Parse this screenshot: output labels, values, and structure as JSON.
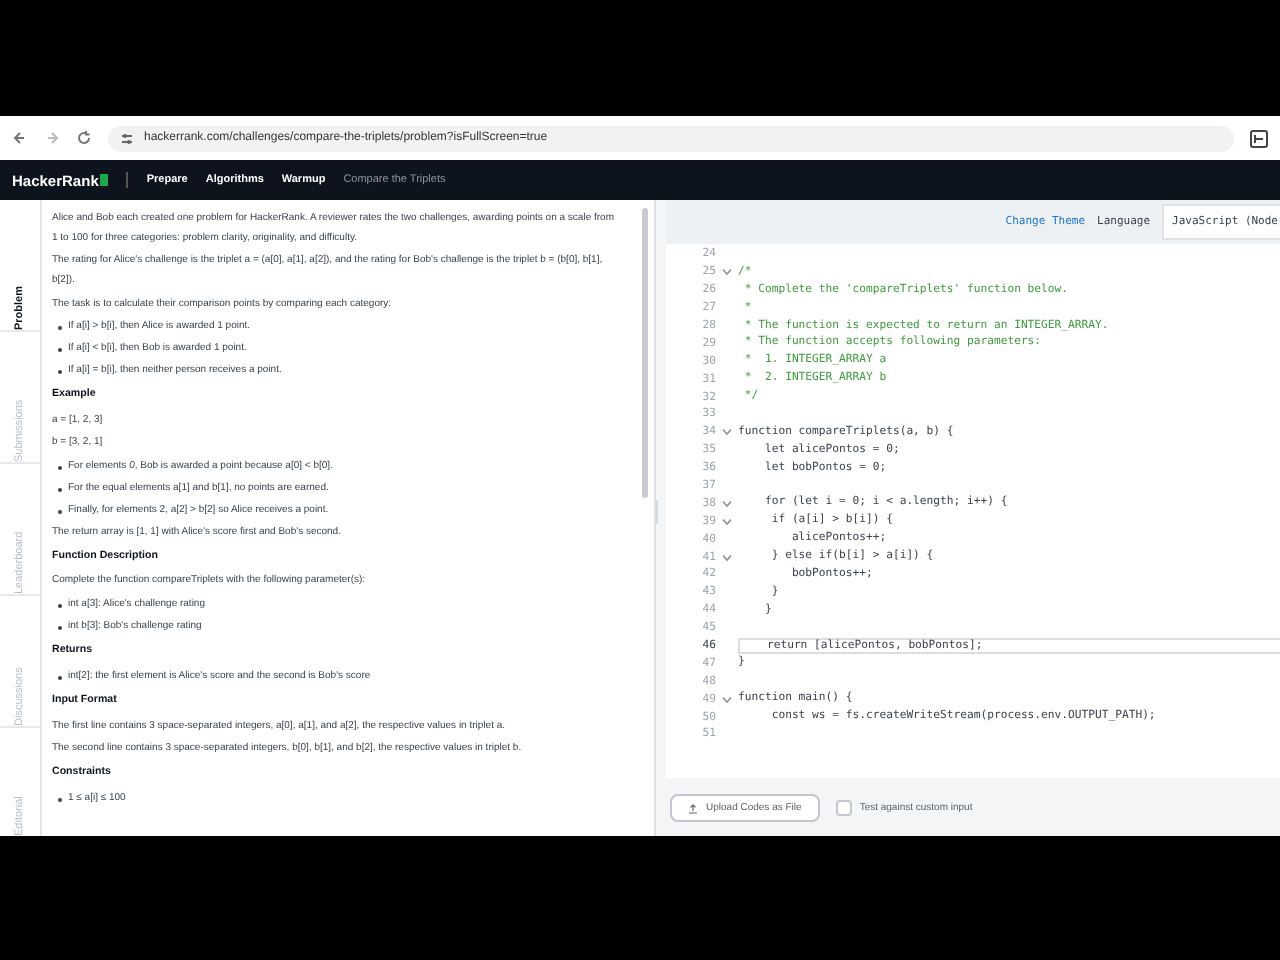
{
  "browser": {
    "url": "hackerrank.com/challenges/compare-the-triplets/problem?isFullScreen=true"
  },
  "header": {
    "logo": "HackerRank",
    "nav": [
      {
        "label": "Prepare",
        "kind": "link"
      },
      {
        "label": "Algorithms",
        "kind": "link"
      },
      {
        "label": "Warmup",
        "kind": "link"
      },
      {
        "label": "Compare the Triplets",
        "kind": "current"
      }
    ]
  },
  "side_tabs": [
    {
      "label": "Problem",
      "selected": true
    },
    {
      "label": "Submissions",
      "selected": false
    },
    {
      "label": "Leaderboard",
      "selected": false
    },
    {
      "label": "Discussions",
      "selected": false
    },
    {
      "label": "Editorial",
      "selected": false
    }
  ],
  "problem": [
    {
      "kind": "p",
      "text": "Alice and Bob each created one problem for HackerRank. A reviewer rates the two challenges, awarding points on a scale from 1 to 100 for three categories: problem clarity, originality, and difficulty."
    },
    {
      "kind": "p",
      "text": "The rating for Alice's challenge is the triplet a = (a[0], a[1], a[2]), and the rating for Bob's challenge is the triplet b = (b[0], b[1], b[2])."
    },
    {
      "kind": "p",
      "text": "The task is to calculate their comparison points by comparing each category:"
    },
    {
      "kind": "li",
      "text": "If a[i] > b[i], then Alice is awarded 1 point."
    },
    {
      "kind": "li",
      "text": "If a[i] < b[i], then Bob is awarded 1 point."
    },
    {
      "kind": "li",
      "text": "If a[i] = b[i], then neither person receives a point."
    },
    {
      "kind": "h",
      "text": "Example"
    },
    {
      "kind": "p",
      "text": "a = [1, 2, 3]"
    },
    {
      "kind": "p",
      "text": "b = [3, 2, 1]"
    },
    {
      "kind": "li",
      "text": "For elements *0*, Bob is awarded a point because a[0] < b[0]."
    },
    {
      "kind": "li",
      "text": "For the equal elements a[1] and b[1], no points are earned."
    },
    {
      "kind": "li",
      "text": "Finally, for elements 2, a[2] > b[2] so Alice receives a point."
    },
    {
      "kind": "p",
      "text": "The return array is [1, 1] with Alice's score first and Bob's second."
    },
    {
      "kind": "h",
      "text": "Function Description"
    },
    {
      "kind": "p",
      "text": "Complete the function compareTriplets with the following parameter(s):"
    },
    {
      "kind": "li",
      "text": "int a[3]: Alice's challenge rating"
    },
    {
      "kind": "li",
      "text": "int b[3]: Bob's challenge rating"
    },
    {
      "kind": "h",
      "text": "Returns"
    },
    {
      "kind": "li",
      "text": "int[2]: the first element is Alice's score and the second is Bob's score"
    },
    {
      "kind": "h",
      "text": "Input Format"
    },
    {
      "kind": "p",
      "text": "The first line contains 3 space-separated integers, a[0], a[1], and a[2], the respective values in triplet a."
    },
    {
      "kind": "p",
      "text": "The second line contains 3 space-separated integers, b[0], b[1], and b[2], the respective values in triplet b."
    },
    {
      "kind": "h",
      "text": "Constraints"
    },
    {
      "kind": "li",
      "text": "1 ≤ a[i] ≤ 100"
    }
  ],
  "editor": {
    "change_theme": "Change Theme",
    "language_label": "Language",
    "language": "JavaScript (Node",
    "lines": [
      {
        "number": "24",
        "kind": "code",
        "fold": false,
        "current": false
      },
      {
        "number": "25",
        "text": "/*",
        "kind": "comment",
        "fold": true,
        "current": false
      },
      {
        "number": "26",
        "text": " * Complete the 'compareTriplets' function below.",
        "kind": "comment",
        "fold": false,
        "current": false
      },
      {
        "number": "27",
        "text": " *",
        "kind": "comment",
        "fold": false,
        "current": false
      },
      {
        "number": "28",
        "text": " * The function is expected to return an INTEGER_ARRAY.",
        "kind": "comment",
        "fold": false,
        "current": false
      },
      {
        "number": "29",
        "text": " * The function accepts following parameters:",
        "kind": "comment",
        "fold": false,
        "current": false
      },
      {
        "number": "30",
        "text": " *  1. INTEGER_ARRAY a",
        "kind": "comment",
        "fold": false,
        "current": false
      },
      {
        "number": "31",
        "text": " *  2. INTEGER_ARRAY b",
        "kind": "comment",
        "fold": false,
        "current": false
      },
      {
        "number": "32",
        "text": " */",
        "kind": "comment",
        "fold": false,
        "current": false
      },
      {
        "number": "33",
        "kind": "code",
        "fold": false,
        "current": false
      },
      {
        "number": "34",
        "text": "function compareTriplets(a, b) {",
        "kind": "code",
        "fold": true,
        "current": false
      },
      {
        "number": "35",
        "text": "    let alicePontos = 0;",
        "kind": "code",
        "fold": false,
        "current": false
      },
      {
        "number": "36",
        "text": "    let bobPontos = 0;",
        "kind": "code",
        "fold": false,
        "current": false
      },
      {
        "number": "37",
        "kind": "code",
        "fold": false,
        "current": false
      },
      {
        "number": "38",
        "text": "    for (let i = 0; i < a.length; i++) {",
        "kind": "code",
        "fold": true,
        "current": false
      },
      {
        "number": "39",
        "text": "     if (a[i] > b[i]) {",
        "kind": "code",
        "fold": true,
        "current": false
      },
      {
        "number": "40",
        "text": "        alicePontos++;",
        "kind": "code",
        "fold": false,
        "current": false
      },
      {
        "number": "41",
        "text": "     } else if(b[i] > a[i]) {",
        "kind": "code",
        "fold": true,
        "current": false
      },
      {
        "number": "42",
        "text": "        bobPontos++;",
        "kind": "code",
        "fold": false,
        "current": false
      },
      {
        "number": "43",
        "text": "     }",
        "kind": "code",
        "fold": false,
        "current": false
      },
      {
        "number": "44",
        "text": "    }",
        "kind": "code",
        "fold": false,
        "current": false
      },
      {
        "number": "45",
        "kind": "code",
        "fold": false,
        "current": false
      },
      {
        "number": "46",
        "text": "    return [alicePontos, bobPontos];",
        "kind": "code",
        "fold": false,
        "current": true
      },
      {
        "number": "47",
        "text": "}",
        "kind": "code",
        "fold": false,
        "current": false
      },
      {
        "number": "48",
        "kind": "code",
        "fold": false,
        "current": false
      },
      {
        "number": "49",
        "text": "function main() {",
        "kind": "code",
        "fold": true,
        "current": false
      },
      {
        "number": "50",
        "text": "     const ws = fs.createWriteStream(process.env.OUTPUT_PATH);",
        "kind": "code",
        "fold": false,
        "current": false
      },
      {
        "number": "51",
        "kind": "code",
        "fold": false,
        "current": false
      }
    ],
    "upload": "Upload Codes as File",
    "custom_input": {
      "label": "Test against custom input",
      "checked": false
    }
  }
}
